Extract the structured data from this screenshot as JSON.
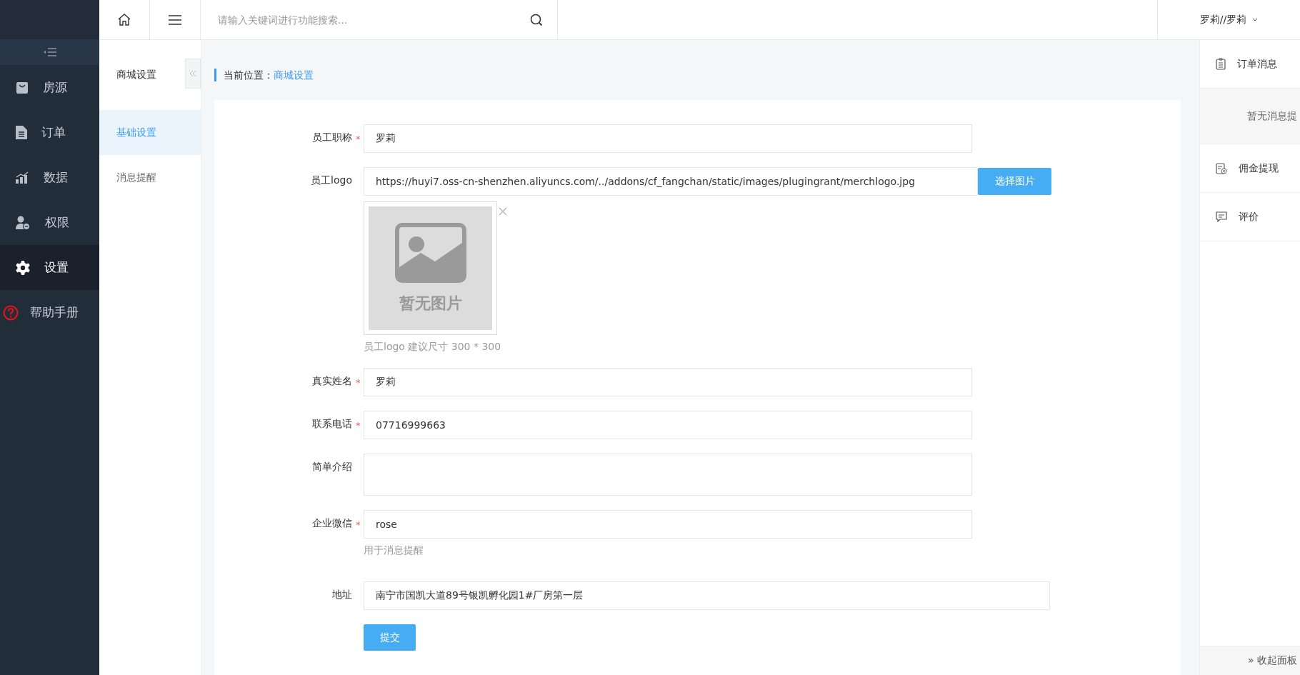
{
  "sidebar": {
    "items": [
      {
        "label": "房源",
        "selected": false
      },
      {
        "label": "订单",
        "selected": false
      },
      {
        "label": "数据",
        "selected": false
      },
      {
        "label": "权限",
        "selected": false
      },
      {
        "label": "设置",
        "selected": true
      },
      {
        "label": "帮助手册",
        "selected": false
      }
    ]
  },
  "topbar": {
    "search": {
      "placeholder": "请输入关键词进行功能搜索..."
    },
    "user": "罗莉//罗莉"
  },
  "subnav": {
    "title": "商城设置",
    "items": [
      {
        "label": "基础设置",
        "selected": true
      },
      {
        "label": "消息提醒",
        "selected": false
      }
    ]
  },
  "breadcrumb": {
    "prefix": "当前位置：",
    "current": "商城设置"
  },
  "form": {
    "fields": [
      {
        "kind": "text",
        "label": "员工职称",
        "required_mark": "*",
        "value": "罗莉"
      },
      {
        "kind": "image",
        "label": "员工logo",
        "value": "https://huyi7.oss-cn-shenzhen.aliyuncs.com/../addons/cf_fangchan/static/images/plugingrant/merchlogo.jpg",
        "button": "选择图片",
        "placeholder_text": "暂无图片",
        "help": "员工logo 建议尺寸 300 * 300"
      },
      {
        "kind": "text",
        "label": "真实姓名",
        "required_mark": "*",
        "value": "罗莉"
      },
      {
        "kind": "text",
        "label": "联系电话",
        "required_mark": "*",
        "value": "07716999663"
      },
      {
        "kind": "textarea",
        "label": "简单介绍"
      },
      {
        "kind": "text",
        "label": "企业微信",
        "required_mark": "*",
        "value": "rose",
        "help": "用于消息提醒"
      },
      {
        "kind": "wide",
        "label": "地址",
        "value": "南宁市国凯大道89号银凯孵化园1#厂房第一层"
      }
    ],
    "submit": "提交"
  },
  "right_panel": {
    "sections": [
      {
        "title": "订单消息",
        "empty": "暂无消息提"
      },
      {
        "title": "佣金提现"
      },
      {
        "title": "评价"
      }
    ],
    "collapse": "» 收起面板"
  }
}
